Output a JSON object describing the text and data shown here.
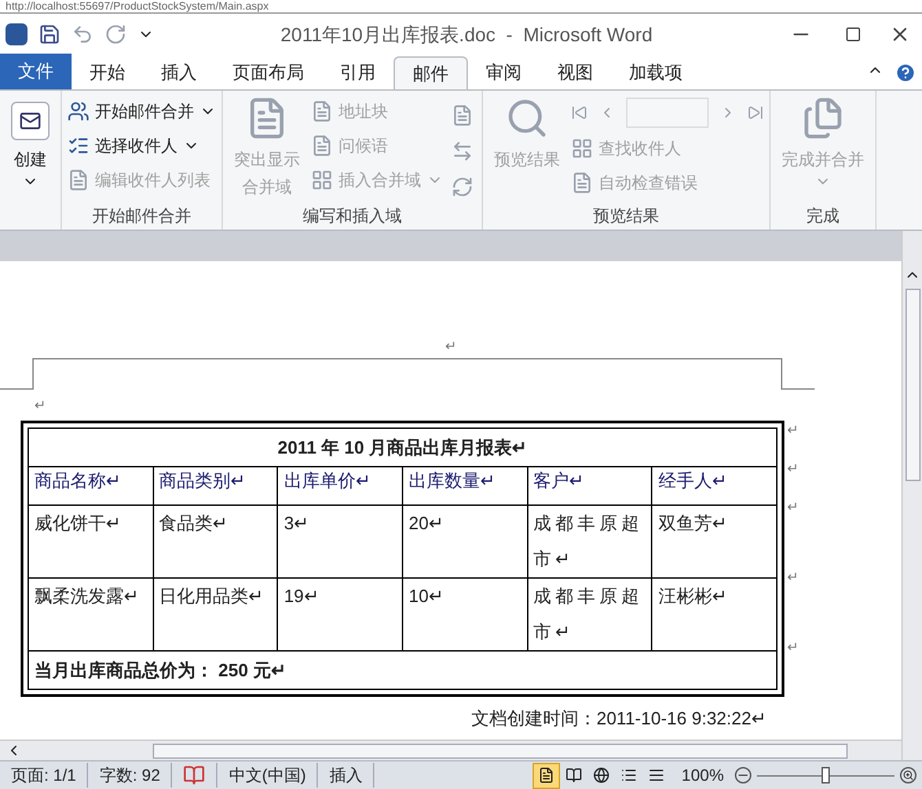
{
  "url_strip": "http://localhost:55697/ProductStockSystem/Main.aspx",
  "window": {
    "title": "2011年10月出库报表.doc  -  Microsoft Word"
  },
  "tabs": [
    {
      "label": "文件",
      "kind": "file",
      "selected": false
    },
    {
      "label": "开始",
      "kind": "tab",
      "selected": false
    },
    {
      "label": "插入",
      "kind": "tab",
      "selected": false
    },
    {
      "label": "页面布局",
      "kind": "tab",
      "selected": false
    },
    {
      "label": "引用",
      "kind": "tab",
      "selected": false
    },
    {
      "label": "邮件",
      "kind": "tab",
      "selected": true
    },
    {
      "label": "审阅",
      "kind": "tab",
      "selected": false
    },
    {
      "label": "视图",
      "kind": "tab",
      "selected": false
    },
    {
      "label": "加载项",
      "kind": "tab",
      "selected": false
    }
  ],
  "ribbon_groups": [
    {
      "items": [
        {
          "kind": "big",
          "label": "创建",
          "dropdown": true,
          "disabled": false
        }
      ]
    },
    {
      "label": "开始邮件合并",
      "items": [
        {
          "kind": "small",
          "label": "开始邮件合并",
          "dropdown": true,
          "disabled": false
        },
        {
          "kind": "small",
          "label": "选择收件人",
          "dropdown": true,
          "disabled": false
        },
        {
          "kind": "small",
          "label": "编辑收件人列表",
          "dropdown": false,
          "disabled": true
        }
      ]
    },
    {
      "label": "编写和插入域",
      "items": [
        {
          "kind": "big",
          "label": "突出显示",
          "label2": "合并域",
          "dropdown": false,
          "disabled": true
        },
        {
          "kind": "small",
          "label": "地址块",
          "dropdown": false,
          "disabled": true
        },
        {
          "kind": "small",
          "label": "问候语",
          "dropdown": false,
          "disabled": true
        },
        {
          "kind": "small",
          "label": "插入合并域",
          "dropdown": true,
          "disabled": true
        },
        {
          "kind": "icon",
          "disabled": true
        },
        {
          "kind": "icon",
          "disabled": true
        },
        {
          "kind": "icon",
          "disabled": true
        }
      ]
    },
    {
      "label": "预览结果",
      "items": [
        {
          "kind": "big",
          "label": "预览结果",
          "dropdown": false,
          "disabled": true
        },
        {
          "kind": "nav",
          "disabled": true
        },
        {
          "kind": "small",
          "label": "查找收件人",
          "dropdown": false,
          "disabled": true
        },
        {
          "kind": "small",
          "label": "自动检查错误",
          "dropdown": false,
          "disabled": true
        }
      ]
    },
    {
      "label": "完成",
      "items": [
        {
          "kind": "big",
          "label": "完成并合并",
          "dropdown": true,
          "disabled": true
        }
      ]
    }
  ],
  "document": {
    "mark": "↵",
    "table": {
      "title": "2011 年 10 月商品出库月报表↵",
      "columns": [
        "商品名称↵",
        "商品类别↵",
        "出库单价↵",
        "出库数量↵",
        "客户↵",
        "经手人↵"
      ],
      "rows": [
        [
          "威化饼干↵",
          "食品类↵",
          "3↵",
          "20↵",
          "成都丰原超市↵",
          "双鱼芳↵"
        ],
        [
          "飘柔洗发露↵",
          "日化用品类↵",
          "19↵",
          "10↵",
          "成都丰原超市↵",
          "汪彬彬↵"
        ]
      ],
      "total": "当月出库商品总价为： 250 元↵"
    },
    "footer_note": "文档创建时间：2011-10-16 9:32:22↵"
  },
  "status_bar": {
    "page": "页面: 1/1",
    "words": "字数: 92",
    "language": "中文(中国)",
    "mode": "插入",
    "views": [
      {
        "selected": true
      },
      {
        "selected": false
      },
      {
        "selected": false
      },
      {
        "selected": false
      },
      {
        "selected": false
      }
    ],
    "zoom": "100%",
    "zoom_slider": {
      "level": 0.5
    }
  }
}
